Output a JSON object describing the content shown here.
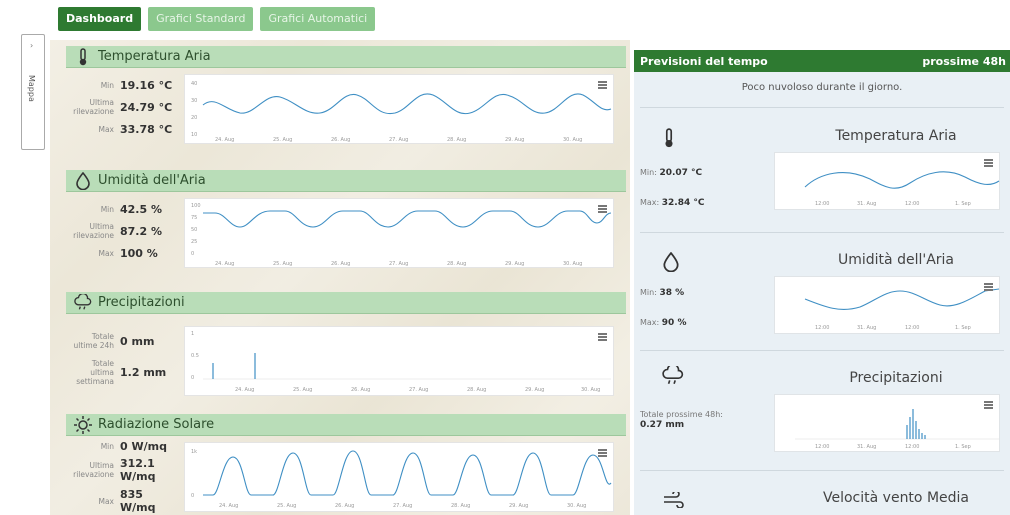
{
  "tabs": [
    {
      "label": "Dashboard",
      "active": true
    },
    {
      "label": "Grafici Standard",
      "active": false
    },
    {
      "label": "Grafici Automatici",
      "active": false
    }
  ],
  "side_tab": {
    "label": "Mappa"
  },
  "panels": [
    {
      "title": "Temperatura Aria",
      "icon": "thermometer-icon",
      "stats": [
        {
          "label": "Min",
          "value": "19.16 °C"
        },
        {
          "label": "Ultima rilevazione",
          "value": "24.79 °C"
        },
        {
          "label": "Max",
          "value": "33.78 °C"
        }
      ],
      "y_ticks": [
        "40",
        "30",
        "20",
        "10"
      ],
      "x_ticks": [
        "24. Aug",
        "25. Aug",
        "26. Aug",
        "27. Aug",
        "28. Aug",
        "29. Aug",
        "30. Aug"
      ]
    },
    {
      "title": "Umidità dell'Aria",
      "icon": "water-drop-icon",
      "stats": [
        {
          "label": "Min",
          "value": "42.5 %"
        },
        {
          "label": "Ultima rilevazione",
          "value": "87.2 %"
        },
        {
          "label": "Max",
          "value": "100 %"
        }
      ],
      "y_ticks": [
        "100",
        "75",
        "50",
        "25",
        "0"
      ],
      "x_ticks": [
        "24. Aug",
        "25. Aug",
        "26. Aug",
        "27. Aug",
        "28. Aug",
        "29. Aug",
        "30. Aug"
      ]
    },
    {
      "title": "Precipitazioni",
      "icon": "rain-cloud-icon",
      "stats": [
        {
          "label": "Totale ultime 24h",
          "value": "0 mm"
        },
        {
          "label": "Totale ultima settimana",
          "value": "1.2 mm"
        }
      ],
      "y_ticks": [
        "1",
        "0.5",
        "0"
      ],
      "x_ticks": [
        "24. Aug",
        "25. Aug",
        "26. Aug",
        "27. Aug",
        "28. Aug",
        "29. Aug",
        "30. Aug"
      ]
    },
    {
      "title": "Radiazione Solare",
      "icon": "sun-icon",
      "stats": [
        {
          "label": "Min",
          "value": "0 W/mq"
        },
        {
          "label": "Ultima rilevazione",
          "value": "312.1 W/mq"
        },
        {
          "label": "Max",
          "value": "835 W/mq"
        }
      ],
      "y_ticks": [
        "1k",
        "0"
      ],
      "x_ticks": [
        "24. Aug",
        "25. Aug",
        "26. Aug",
        "27. Aug",
        "28. Aug",
        "29. Aug",
        "30. Aug"
      ]
    }
  ],
  "forecast": {
    "title": "Previsioni del tempo",
    "range": "prossime 48h",
    "summary": "Poco nuvoloso durante il giorno.",
    "sections": [
      {
        "title": "Temperatura Aria",
        "icon": "thermometer-icon",
        "lines": [
          {
            "label": "Min:",
            "value": "20.07 °C"
          },
          {
            "label": "Max:",
            "value": "32.84 °C"
          }
        ],
        "x_ticks": [
          "12:00",
          "31. Aug",
          "12:00",
          "1. Sep"
        ]
      },
      {
        "title": "Umidità dell'Aria",
        "icon": "water-drop-icon",
        "lines": [
          {
            "label": "Min:",
            "value": "38 %"
          },
          {
            "label": "Max:",
            "value": "90 %"
          }
        ],
        "x_ticks": [
          "12:00",
          "31. Aug",
          "12:00",
          "1. Sep"
        ]
      },
      {
        "title": "Precipitazioni",
        "icon": "rain-cloud-icon",
        "lines": [
          {
            "label": "Totale prossime 48h:",
            "value": "0.27 mm"
          }
        ],
        "x_ticks": [
          "12:00",
          "31. Aug",
          "12:00",
          "1. Sep"
        ]
      },
      {
        "title": "Velocità vento Media",
        "icon": "wind-icon",
        "lines": [],
        "x_ticks": []
      }
    ]
  },
  "colors": {
    "accent": "#2e7a31",
    "panel_header": "#b9ddb8",
    "line": "#3f8fc4",
    "tab_inactive": "#8bc88d"
  }
}
